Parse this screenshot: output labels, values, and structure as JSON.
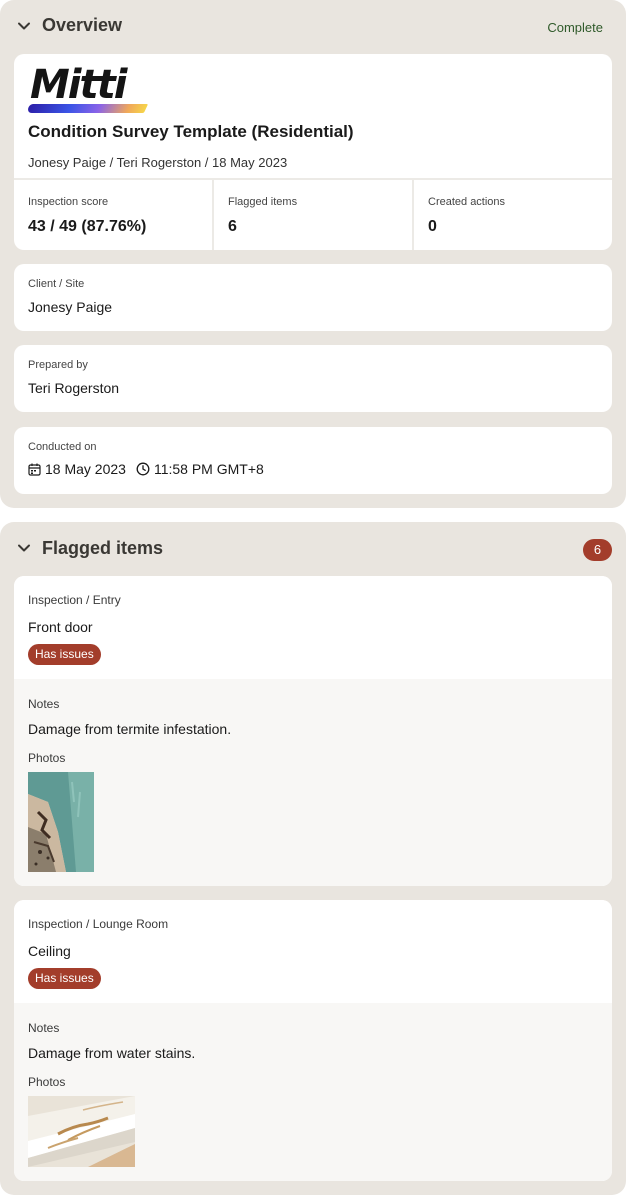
{
  "overview": {
    "title": "Overview",
    "status": "Complete",
    "logo_text": "Mitti",
    "document_title": "Condition Survey Template (Residential)",
    "subtitle": "Jonesy Paige / Teri Rogerston / 18 May 2023",
    "stats": [
      {
        "label": "Inspection score",
        "value": "43 / 49 (87.76%)"
      },
      {
        "label": "Flagged items",
        "value": "6"
      },
      {
        "label": "Created actions",
        "value": "0"
      }
    ],
    "client": {
      "label": "Client / Site",
      "value": "Jonesy Paige"
    },
    "prepared": {
      "label": "Prepared by",
      "value": "Teri Rogerston"
    },
    "conducted": {
      "label": "Conducted on",
      "date": "18 May 2023",
      "time": "11:58 PM GMT+8"
    }
  },
  "flagged": {
    "title": "Flagged items",
    "count": "6",
    "items": [
      {
        "path": "Inspection / Entry",
        "name": "Front door",
        "badge": "Has issues",
        "notes_label": "Notes",
        "notes": "Damage from termite infestation.",
        "photos_label": "Photos",
        "photo_icon": "termite-damage-photo"
      },
      {
        "path": "Inspection / Lounge Room",
        "name": "Ceiling",
        "badge": "Has issues",
        "notes_label": "Notes",
        "notes": "Damage from water stains.",
        "photos_label": "Photos",
        "photo_icon": "water-stain-photo"
      }
    ]
  },
  "colors": {
    "panel_bg": "#e9e5df",
    "accent_red": "#a33d2b",
    "complete_green": "#2f5a2a"
  }
}
